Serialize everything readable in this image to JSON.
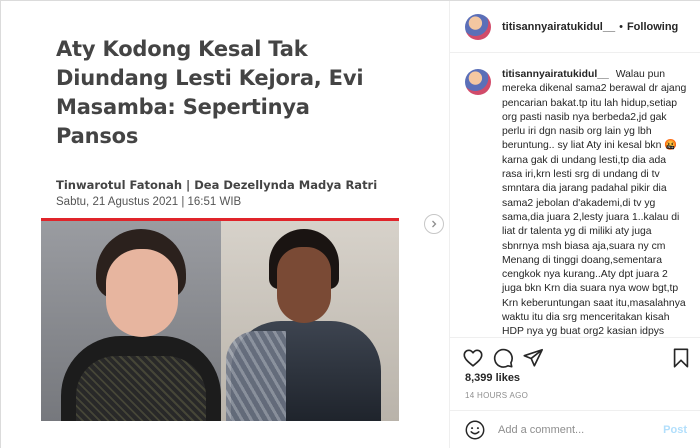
{
  "article": {
    "headline": "Aty Kodong Kesal Tak Diundang Lesti Kejora, Evi Masamba: Sepertinya Pansos",
    "authors": "Tinwarotul Fatonah | Dea Dezellynda Madya Ratri",
    "date": "Sabtu, 21 Agustus 2021 | 16:51 WIB"
  },
  "media": {
    "next_icon": "chevron-right-icon"
  },
  "post": {
    "username": "titisannyairatukidul__",
    "separator": "•",
    "follow_label": "Following",
    "caption_user": "titisannyairatukidul__",
    "caption_text": "Walau pun mereka dikenal sama2 berawal dr ajang pencarian bakat.tp itu lah hidup,setiap org pasti nasib nya berbeda2,jd gak perlu iri dgn nasib org lain yg lbh beruntung.. sy liat Aty ini kesal bkn 🤬 karna gak di undang lesti,tp dia ada rasa iri,krn lesti srg di undang di tv smntara dia jarang padahal pikir dia sama2 jebolan d'akademi,di tv yg sama,dia juara 2,lesty juara 1..kalau di liat dr talenta yg di miliki aty juga sbnrnya msh biasa aja,suara ny cm Menang di tinggi doang,sementara cengkok nya kurang..Aty dpt juara 2 juga bkn Krn dia suara nya wow bgt,tp Krn keberuntungan saat itu,masalahnya waktu itu dia srg menceritakan kisah HDP nya yg buat org2 kasian idpys",
    "likes": "8,399 likes",
    "time_ago": "14 HOURS AGO",
    "comment_placeholder": "Add a comment...",
    "post_label": "Post",
    "icons": [
      "heart-icon",
      "comment-icon",
      "share-icon",
      "bookmark-icon",
      "emoji-icon"
    ]
  },
  "colors": {
    "accent_red": "#e0242a",
    "post_button": "#b2dffc",
    "muted_text": "#8e8e8e"
  }
}
